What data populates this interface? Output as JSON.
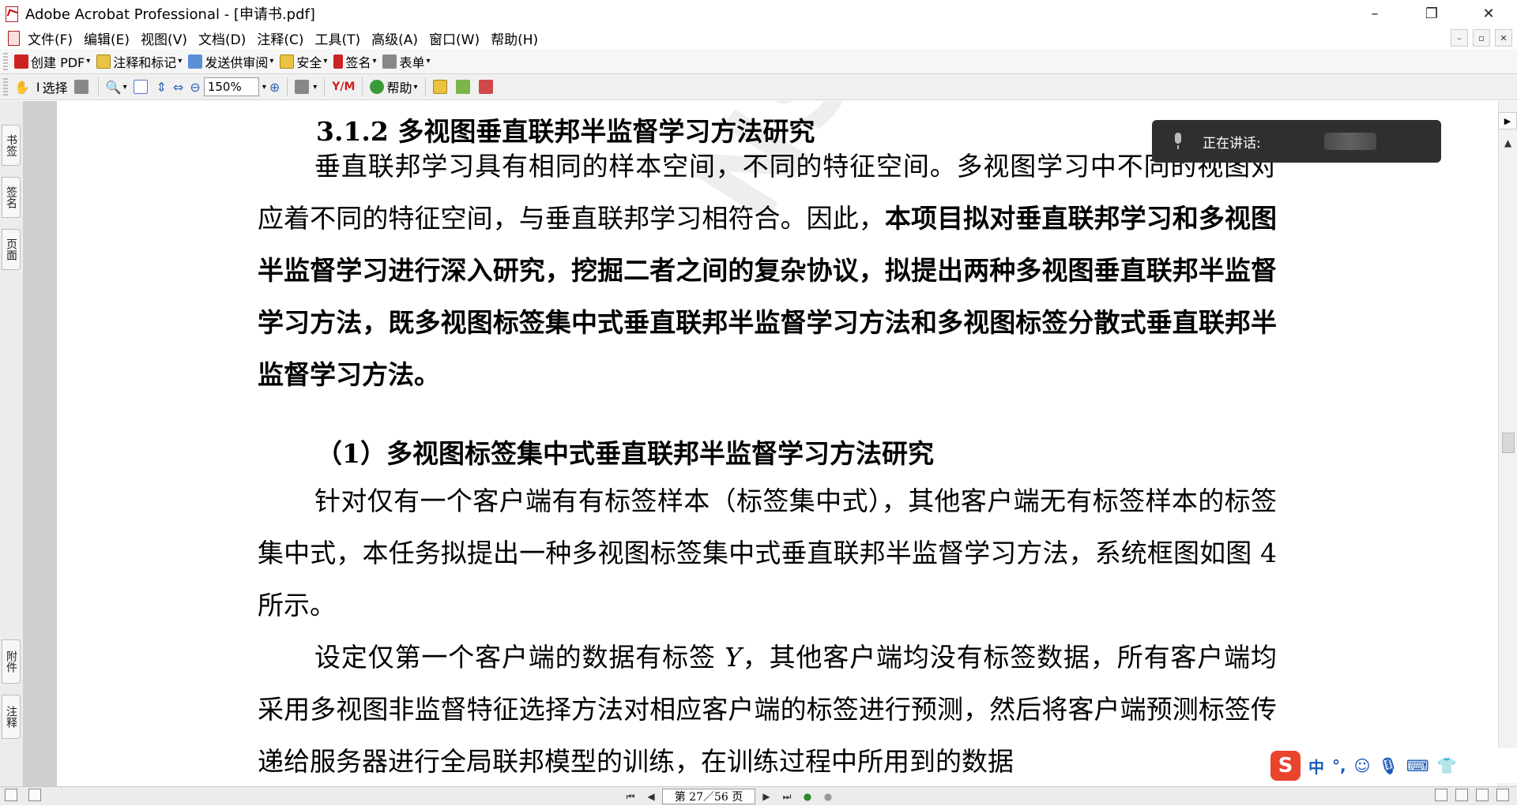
{
  "window": {
    "title": "Adobe Acrobat Professional - [申请书.pdf]",
    "minimize": "–",
    "restore": "❐",
    "close": "✕"
  },
  "menu": {
    "items": [
      "文件(F)",
      "编辑(E)",
      "视图(V)",
      "文档(D)",
      "注释(C)",
      "工具(T)",
      "高级(A)",
      "窗口(W)",
      "帮助(H)"
    ],
    "doc_min": "–",
    "doc_restore": "▫",
    "doc_close": "✕"
  },
  "toolbar1": {
    "create_pdf": "创建 PDF",
    "comment_markup": "注释和标记",
    "send_review": "发送供审阅",
    "security": "安全",
    "sign": "签名",
    "forms": "表单"
  },
  "toolbar2": {
    "select": "选择",
    "zoom_value": "150%",
    "help": "帮助",
    "ym_label": "Y∕M"
  },
  "sidebar": {
    "tabs_top": [
      "书签",
      "签名",
      "页面"
    ],
    "tabs_bottom": [
      "附件",
      "注释"
    ]
  },
  "document": {
    "heading": "3.1.2 多视图垂直联邦半监督学习方法研究",
    "para1_normal": "垂直联邦学习具有相同的样本空间，不同的特征空间。多视图学习中不同的视图对应着不同的特征空间，与垂直联邦学习相符合。因此，",
    "para1_bold": "本项目拟对垂直联邦学习和多视图半监督学习进行深入研究，挖掘二者之间的复杂协议，拟提出两种多视图垂直联邦半监督学习方法，既多视图标签集中式垂直联邦半监督学习方法和多视图标签分散式垂直联邦半监督学习方法。",
    "subheading": "（1）多视图标签集中式垂直联邦半监督学习方法研究",
    "para2": "针对仅有一个客户端有有标签样本（标签集中式），其他客户端无有标签样本的标签集中式，本任务拟提出一种多视图标签集中式垂直联邦半监督学习方法，系统框图如图 4 所示。",
    "para3_a": "设定仅第一个客户端的数据有标签 ",
    "para3_var": "Y",
    "para3_b": "，其他客户端均没有标签数据，所有客户端均采用多视图非监督特征选择方法对相应客户端的标签进行预测，然后将客户端预测标签传递给服务器进行全局联邦模型的训练，在训练过程中所用到的数据",
    "watermark": "NSFC"
  },
  "overlay": {
    "speaking_label": "正在讲话:"
  },
  "status": {
    "page_indicator": "第 27／56 页"
  },
  "ime": {
    "logo": "S",
    "items": [
      "中",
      "°,",
      "☺",
      "🎙",
      "⌨",
      "👕"
    ]
  }
}
